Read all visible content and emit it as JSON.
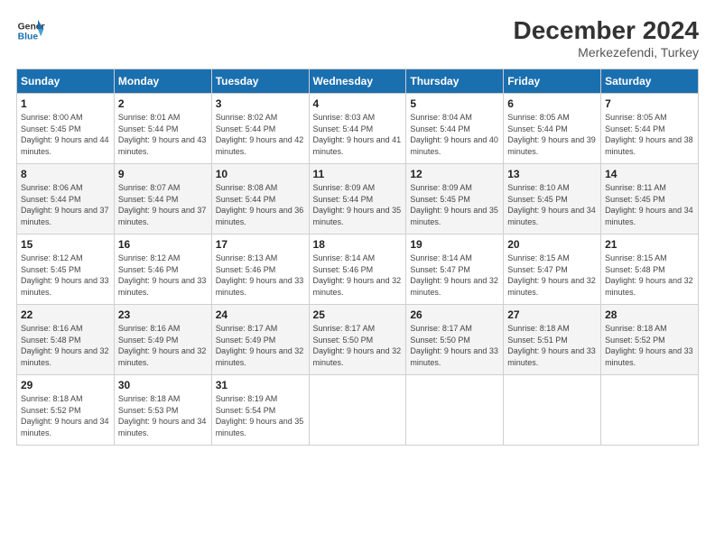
{
  "logo": {
    "line1": "General",
    "line2": "Blue"
  },
  "title": "December 2024",
  "subtitle": "Merkezefendi, Turkey",
  "weekdays": [
    "Sunday",
    "Monday",
    "Tuesday",
    "Wednesday",
    "Thursday",
    "Friday",
    "Saturday"
  ],
  "weeks": [
    [
      {
        "day": "1",
        "sunrise": "8:00 AM",
        "sunset": "5:45 PM",
        "daylight": "9 hours and 44 minutes."
      },
      {
        "day": "2",
        "sunrise": "8:01 AM",
        "sunset": "5:44 PM",
        "daylight": "9 hours and 43 minutes."
      },
      {
        "day": "3",
        "sunrise": "8:02 AM",
        "sunset": "5:44 PM",
        "daylight": "9 hours and 42 minutes."
      },
      {
        "day": "4",
        "sunrise": "8:03 AM",
        "sunset": "5:44 PM",
        "daylight": "9 hours and 41 minutes."
      },
      {
        "day": "5",
        "sunrise": "8:04 AM",
        "sunset": "5:44 PM",
        "daylight": "9 hours and 40 minutes."
      },
      {
        "day": "6",
        "sunrise": "8:05 AM",
        "sunset": "5:44 PM",
        "daylight": "9 hours and 39 minutes."
      },
      {
        "day": "7",
        "sunrise": "8:05 AM",
        "sunset": "5:44 PM",
        "daylight": "9 hours and 38 minutes."
      }
    ],
    [
      {
        "day": "8",
        "sunrise": "8:06 AM",
        "sunset": "5:44 PM",
        "daylight": "9 hours and 37 minutes."
      },
      {
        "day": "9",
        "sunrise": "8:07 AM",
        "sunset": "5:44 PM",
        "daylight": "9 hours and 37 minutes."
      },
      {
        "day": "10",
        "sunrise": "8:08 AM",
        "sunset": "5:44 PM",
        "daylight": "9 hours and 36 minutes."
      },
      {
        "day": "11",
        "sunrise": "8:09 AM",
        "sunset": "5:44 PM",
        "daylight": "9 hours and 35 minutes."
      },
      {
        "day": "12",
        "sunrise": "8:09 AM",
        "sunset": "5:45 PM",
        "daylight": "9 hours and 35 minutes."
      },
      {
        "day": "13",
        "sunrise": "8:10 AM",
        "sunset": "5:45 PM",
        "daylight": "9 hours and 34 minutes."
      },
      {
        "day": "14",
        "sunrise": "8:11 AM",
        "sunset": "5:45 PM",
        "daylight": "9 hours and 34 minutes."
      }
    ],
    [
      {
        "day": "15",
        "sunrise": "8:12 AM",
        "sunset": "5:45 PM",
        "daylight": "9 hours and 33 minutes."
      },
      {
        "day": "16",
        "sunrise": "8:12 AM",
        "sunset": "5:46 PM",
        "daylight": "9 hours and 33 minutes."
      },
      {
        "day": "17",
        "sunrise": "8:13 AM",
        "sunset": "5:46 PM",
        "daylight": "9 hours and 33 minutes."
      },
      {
        "day": "18",
        "sunrise": "8:14 AM",
        "sunset": "5:46 PM",
        "daylight": "9 hours and 32 minutes."
      },
      {
        "day": "19",
        "sunrise": "8:14 AM",
        "sunset": "5:47 PM",
        "daylight": "9 hours and 32 minutes."
      },
      {
        "day": "20",
        "sunrise": "8:15 AM",
        "sunset": "5:47 PM",
        "daylight": "9 hours and 32 minutes."
      },
      {
        "day": "21",
        "sunrise": "8:15 AM",
        "sunset": "5:48 PM",
        "daylight": "9 hours and 32 minutes."
      }
    ],
    [
      {
        "day": "22",
        "sunrise": "8:16 AM",
        "sunset": "5:48 PM",
        "daylight": "9 hours and 32 minutes."
      },
      {
        "day": "23",
        "sunrise": "8:16 AM",
        "sunset": "5:49 PM",
        "daylight": "9 hours and 32 minutes."
      },
      {
        "day": "24",
        "sunrise": "8:17 AM",
        "sunset": "5:49 PM",
        "daylight": "9 hours and 32 minutes."
      },
      {
        "day": "25",
        "sunrise": "8:17 AM",
        "sunset": "5:50 PM",
        "daylight": "9 hours and 32 minutes."
      },
      {
        "day": "26",
        "sunrise": "8:17 AM",
        "sunset": "5:50 PM",
        "daylight": "9 hours and 33 minutes."
      },
      {
        "day": "27",
        "sunrise": "8:18 AM",
        "sunset": "5:51 PM",
        "daylight": "9 hours and 33 minutes."
      },
      {
        "day": "28",
        "sunrise": "8:18 AM",
        "sunset": "5:52 PM",
        "daylight": "9 hours and 33 minutes."
      }
    ],
    [
      {
        "day": "29",
        "sunrise": "8:18 AM",
        "sunset": "5:52 PM",
        "daylight": "9 hours and 34 minutes."
      },
      {
        "day": "30",
        "sunrise": "8:18 AM",
        "sunset": "5:53 PM",
        "daylight": "9 hours and 34 minutes."
      },
      {
        "day": "31",
        "sunrise": "8:19 AM",
        "sunset": "5:54 PM",
        "daylight": "9 hours and 35 minutes."
      },
      null,
      null,
      null,
      null
    ]
  ]
}
